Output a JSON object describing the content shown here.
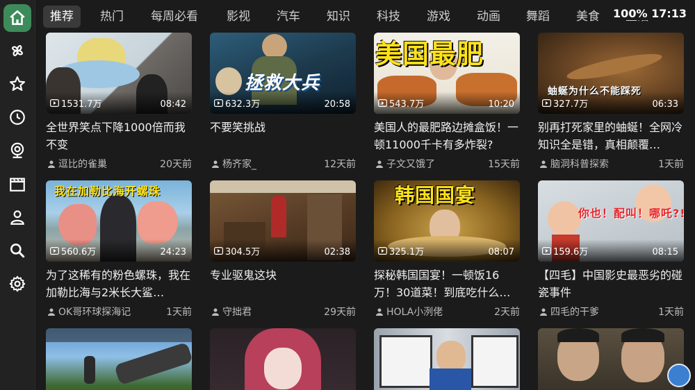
{
  "sidebar": {
    "items": [
      {
        "icon": "home-icon",
        "active": true
      },
      {
        "icon": "pinwheel-icon"
      },
      {
        "icon": "star-icon"
      },
      {
        "icon": "clock-icon"
      },
      {
        "icon": "webcam-icon"
      },
      {
        "icon": "clapperboard-icon"
      },
      {
        "icon": "person-icon"
      },
      {
        "icon": "search-icon"
      },
      {
        "icon": "gear-icon"
      }
    ],
    "accent": "#3d8b5a"
  },
  "tabs": [
    "推荐",
    "热门",
    "每周必看",
    "影视",
    "汽车",
    "知识",
    "科技",
    "游戏",
    "动画",
    "舞蹈",
    "美食",
    "生活"
  ],
  "status": {
    "battery": "100%",
    "time": "17:13"
  },
  "videos": [
    {
      "views": "1531.7万",
      "duration": "08:42",
      "title": "全世界笑点下降1000倍而我不变",
      "author": "逗比的雀巢",
      "age": "20天前"
    },
    {
      "views": "632.3万",
      "duration": "20:58",
      "title": "不要笑挑战",
      "author": "杨齐家_",
      "age": "12天前",
      "thumb_text": "拯救大兵"
    },
    {
      "views": "543.7万",
      "duration": "10:20",
      "title": "美国人的最肥路边摊盒饭！一顿11000千卡有多炸裂?",
      "author": "子文又饿了",
      "age": "15天前",
      "thumb_text": "美国最肥"
    },
    {
      "views": "327.7万",
      "duration": "06:33",
      "title": "别再打死家里的蚰蜒！全网冷知识全是错，真相颠覆…",
      "author": "脑洞科普探索",
      "age": "1天前",
      "thumb_text": "蚰蜒为什么不能踩死"
    },
    {
      "views": "560.6万",
      "duration": "24:23",
      "title": "为了这稀有的粉色螺珠，我在加勒比海与2米长大鲨…",
      "author": "OK哥环球探海记",
      "age": "1天前",
      "thumb_text": "我在加勒比海开螺珠"
    },
    {
      "views": "304.5万",
      "duration": "02:38",
      "title": "专业驱鬼这块",
      "author": "守拙君",
      "age": "29天前"
    },
    {
      "views": "325.1万",
      "duration": "08:07",
      "title": "探秘韩国国宴！一顿饭16万！30道菜！到底吃什么…",
      "author": "HOLA小洌佬",
      "age": "2天前",
      "thumb_text": "韩国国宴"
    },
    {
      "views": "159.6万",
      "duration": "08:15",
      "title": "【四毛】中国影史最恶劣的碰瓷事件",
      "author": "四毛的干爹",
      "age": "1天前",
      "thumb_text": "你也！配叫！哪吒?!"
    }
  ]
}
